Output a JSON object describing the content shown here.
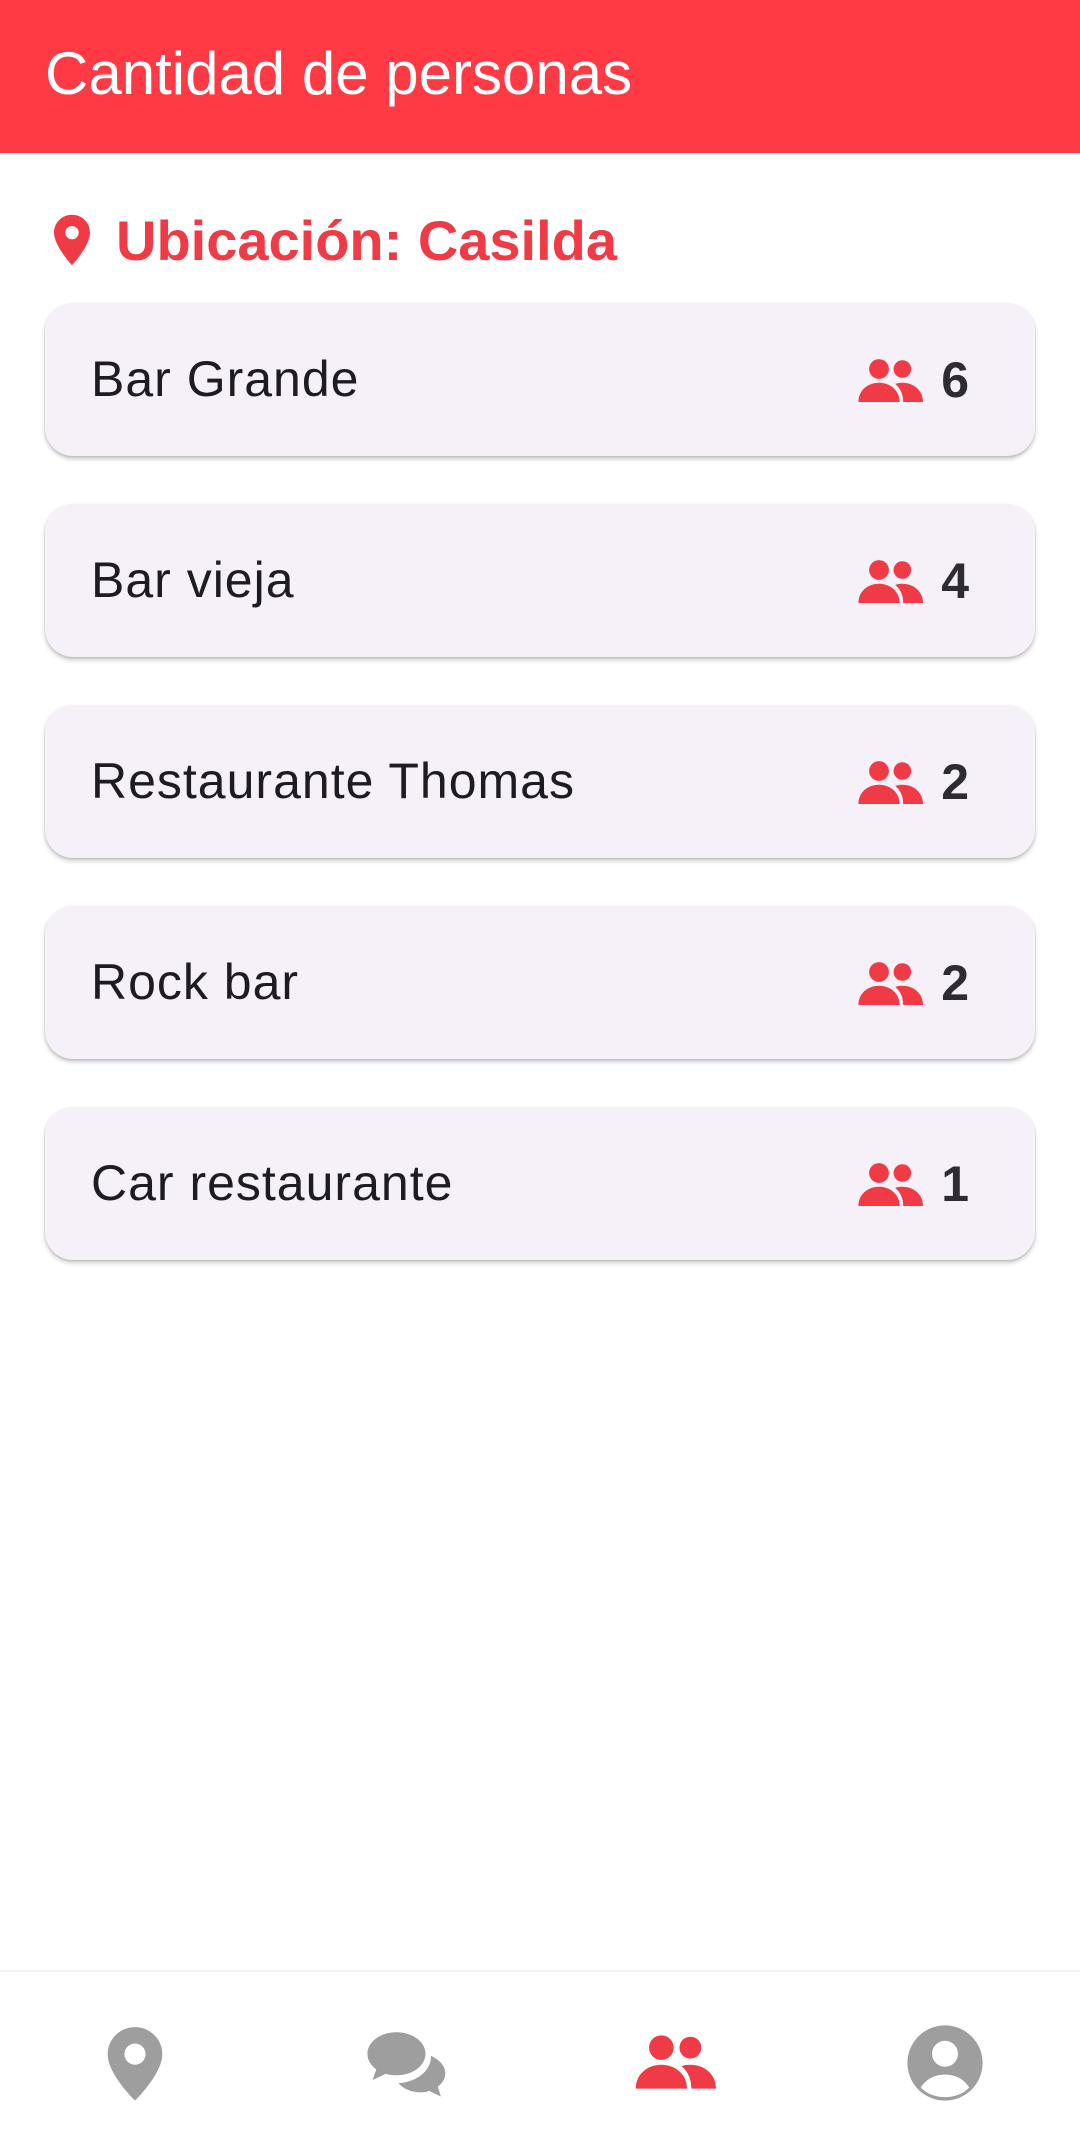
{
  "app_bar": {
    "title": "Cantidad de personas",
    "color": "#FF3A44"
  },
  "location": {
    "icon": "location-pin-icon",
    "text": "Ubicación: Casilda",
    "color": "#F03A46"
  },
  "places": [
    {
      "name": "Bar Grande",
      "count": "6",
      "icon": "group-icon"
    },
    {
      "name": "Bar vieja",
      "count": "4",
      "icon": "group-icon"
    },
    {
      "name": "Restaurante Thomas",
      "count": "2",
      "icon": "group-icon"
    },
    {
      "name": "Rock bar",
      "count": "2",
      "icon": "group-icon"
    },
    {
      "name": "Car restaurante",
      "count": "1",
      "icon": "group-icon"
    }
  ],
  "bottom_nav": {
    "items": [
      {
        "icon": "location-pin-icon",
        "active": false
      },
      {
        "icon": "chat-icon",
        "active": false
      },
      {
        "icon": "group-icon",
        "active": true
      },
      {
        "icon": "account-icon",
        "active": false
      }
    ],
    "active_color": "#F03A46",
    "inactive_color": "#9E9E9E"
  }
}
